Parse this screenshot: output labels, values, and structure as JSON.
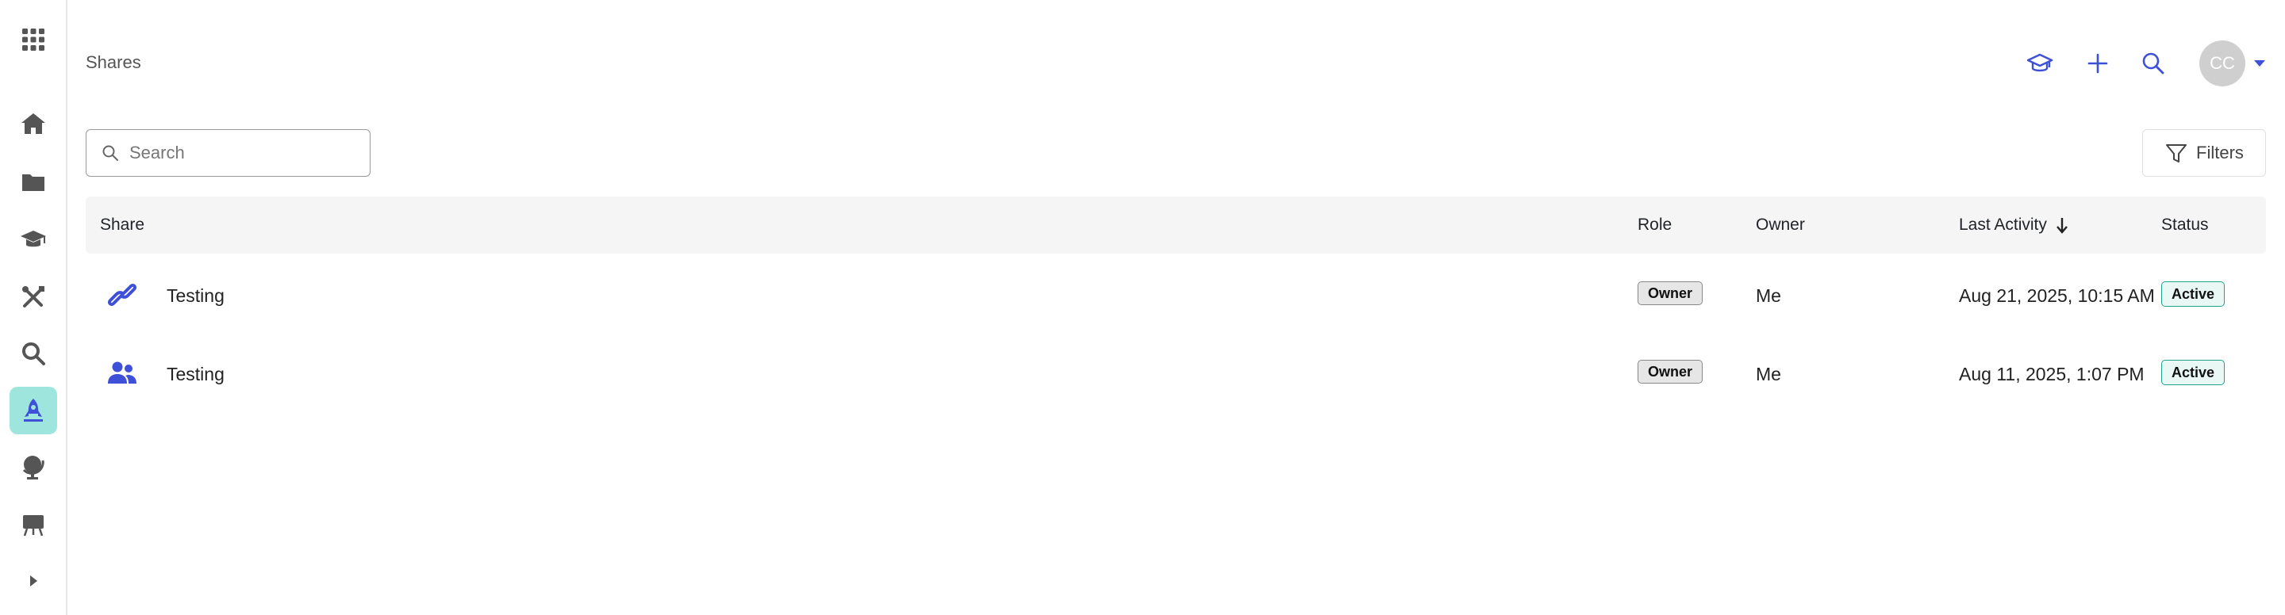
{
  "header": {
    "title": "Shares",
    "avatar_initials": "CC"
  },
  "search": {
    "placeholder": "Search"
  },
  "filters": {
    "label": "Filters"
  },
  "table": {
    "columns": [
      "Share",
      "Role",
      "Owner",
      "Last Activity",
      "Status"
    ],
    "rows": [
      {
        "icon": "link-icon",
        "name": "Testing",
        "role": "Owner",
        "owner": "Me",
        "last_activity": "Aug 21, 2025, 10:15 AM",
        "status": "Active"
      },
      {
        "icon": "users-icon",
        "name": "Testing",
        "role": "Owner",
        "owner": "Me",
        "last_activity": "Aug 11, 2025, 1:07 PM",
        "status": "Active"
      }
    ]
  },
  "sidebar": {
    "items": [
      "apps-grid-icon",
      "home-icon",
      "folder-icon",
      "graduation-cap-icon",
      "tools-icon",
      "search-icon",
      "rocket-icon",
      "globe-icon",
      "presentation-icon",
      "expand-icon"
    ]
  },
  "colors": {
    "accent": "#3e4fd8",
    "active_sidebar": "#9ee6dd",
    "status_border": "#1fa38d"
  }
}
